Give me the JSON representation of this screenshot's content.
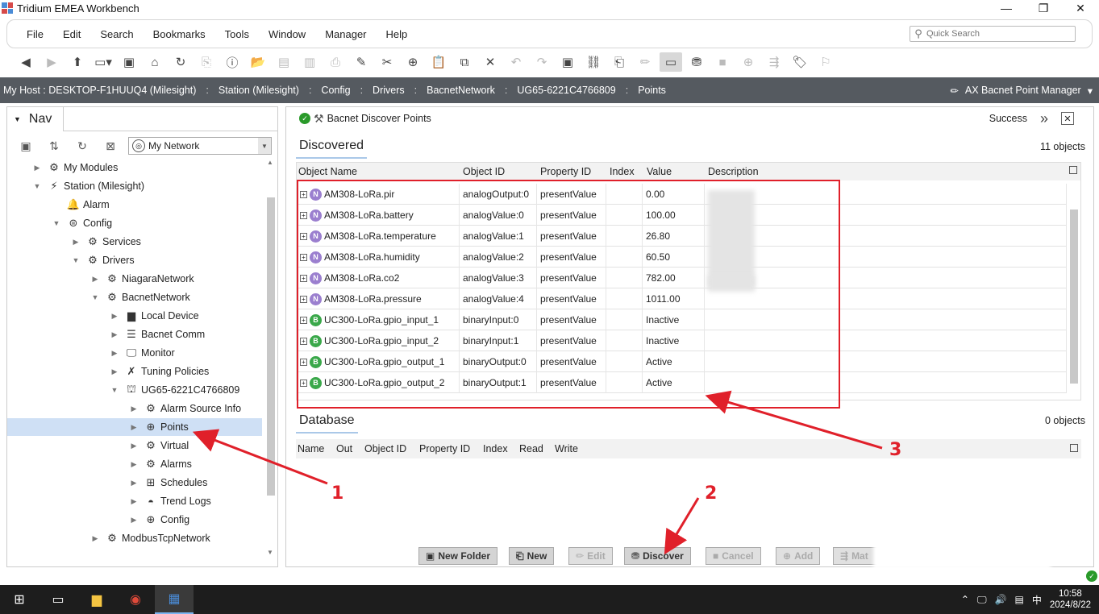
{
  "window": {
    "title": "Tridium EMEA Workbench",
    "minimize": "—",
    "maximize": "❐",
    "close": "✕"
  },
  "menu": [
    "File",
    "Edit",
    "Search",
    "Bookmarks",
    "Tools",
    "Window",
    "Manager",
    "Help"
  ],
  "quick_search": {
    "placeholder": "Quick Search"
  },
  "breadcrumb": [
    "My Host : DESKTOP-F1HUUQ4 (Milesight)",
    "Station (Milesight)",
    "Config",
    "Drivers",
    "BacnetNetwork",
    "UG65-6221C4766809",
    "Points"
  ],
  "view_selector": "AX Bacnet Point Manager",
  "nav": {
    "tab": "Nav",
    "network_select": "My Network",
    "tree": [
      {
        "label": "My Modules",
        "depth": 1,
        "exp": "▶",
        "icon": "module-icon",
        "glyph": "⚙"
      },
      {
        "label": "Station (Milesight)",
        "depth": 1,
        "exp": "▼",
        "icon": "station-icon",
        "glyph": "⚡"
      },
      {
        "label": "Alarm",
        "depth": 2,
        "exp": "",
        "icon": "bell-icon",
        "glyph": "🔔"
      },
      {
        "label": "Config",
        "depth": 2,
        "exp": "▼",
        "icon": "config-icon",
        "glyph": "⊜"
      },
      {
        "label": "Services",
        "depth": 3,
        "exp": "▶",
        "icon": "services-icon",
        "glyph": "⚙"
      },
      {
        "label": "Drivers",
        "depth": 3,
        "exp": "▼",
        "icon": "drivers-icon",
        "glyph": "⚙"
      },
      {
        "label": "NiagaraNetwork",
        "depth": 4,
        "exp": "▶",
        "icon": "network-icon",
        "glyph": "⚙"
      },
      {
        "label": "BacnetNetwork",
        "depth": 4,
        "exp": "▼",
        "icon": "network-icon",
        "glyph": "⚙"
      },
      {
        "label": "Local Device",
        "depth": 5,
        "exp": "▶",
        "icon": "device-icon",
        "glyph": "▆"
      },
      {
        "label": "Bacnet Comm",
        "depth": 5,
        "exp": "▶",
        "icon": "comm-icon",
        "glyph": "☰"
      },
      {
        "label": "Monitor",
        "depth": 5,
        "exp": "▶",
        "icon": "monitor-icon",
        "glyph": "🖵"
      },
      {
        "label": "Tuning Policies",
        "depth": 5,
        "exp": "▶",
        "icon": "tuning-icon",
        "glyph": "✗"
      },
      {
        "label": "UG65-6221C4766809",
        "depth": 5,
        "exp": "▼",
        "icon": "device-icon",
        "glyph": "⛫"
      },
      {
        "label": "Alarm Source Info",
        "depth": 6,
        "exp": "▶",
        "icon": "alarm-source-icon",
        "glyph": "⚙"
      },
      {
        "label": "Points",
        "depth": 6,
        "exp": "▶",
        "icon": "points-icon",
        "glyph": "⊕",
        "selected": true
      },
      {
        "label": "Virtual",
        "depth": 6,
        "exp": "▶",
        "icon": "virtual-icon",
        "glyph": "⚙"
      },
      {
        "label": "Alarms",
        "depth": 6,
        "exp": "▶",
        "icon": "alarms-icon",
        "glyph": "⚙"
      },
      {
        "label": "Schedules",
        "depth": 6,
        "exp": "▶",
        "icon": "schedules-icon",
        "glyph": "⊞"
      },
      {
        "label": "Trend Logs",
        "depth": 6,
        "exp": "▶",
        "icon": "trend-icon",
        "glyph": "◓"
      },
      {
        "label": "Config",
        "depth": 6,
        "exp": "▶",
        "icon": "config-icon",
        "glyph": "⊕"
      },
      {
        "label": "ModbusTcpNetwork",
        "depth": 4,
        "exp": "▶",
        "icon": "network-icon",
        "glyph": "⚙"
      }
    ]
  },
  "main": {
    "panel_title": "Bacnet Discover Points",
    "status": "Success",
    "discovered": {
      "tab": "Discovered",
      "count": "11 objects",
      "columns": [
        "Object Name",
        "Object ID",
        "Property ID",
        "Index",
        "Value",
        "Description"
      ],
      "rows": [
        {
          "type": "N",
          "color": "#9b7fcf",
          "name": "AM308-LoRa.pir",
          "object_id": "analogOutput:0",
          "property": "presentValue",
          "index": "",
          "value": "0.00"
        },
        {
          "type": "N",
          "color": "#9b7fcf",
          "name": "AM308-LoRa.battery",
          "object_id": "analogValue:0",
          "property": "presentValue",
          "index": "",
          "value": "100.00"
        },
        {
          "type": "N",
          "color": "#9b7fcf",
          "name": "AM308-LoRa.temperature",
          "object_id": "analogValue:1",
          "property": "presentValue",
          "index": "",
          "value": "26.80"
        },
        {
          "type": "N",
          "color": "#9b7fcf",
          "name": "AM308-LoRa.humidity",
          "object_id": "analogValue:2",
          "property": "presentValue",
          "index": "",
          "value": "60.50"
        },
        {
          "type": "N",
          "color": "#9b7fcf",
          "name": "AM308-LoRa.co2",
          "object_id": "analogValue:3",
          "property": "presentValue",
          "index": "",
          "value": "782.00"
        },
        {
          "type": "N",
          "color": "#9b7fcf",
          "name": "AM308-LoRa.pressure",
          "object_id": "analogValue:4",
          "property": "presentValue",
          "index": "",
          "value": "1011.00"
        },
        {
          "type": "B",
          "color": "#3aa84a",
          "name": "UC300-LoRa.gpio_input_1",
          "object_id": "binaryInput:0",
          "property": "presentValue",
          "index": "",
          "value": "Inactive"
        },
        {
          "type": "B",
          "color": "#3aa84a",
          "name": "UC300-LoRa.gpio_input_2",
          "object_id": "binaryInput:1",
          "property": "presentValue",
          "index": "",
          "value": "Inactive"
        },
        {
          "type": "B",
          "color": "#3aa84a",
          "name": "UC300-LoRa.gpio_output_1",
          "object_id": "binaryOutput:0",
          "property": "presentValue",
          "index": "",
          "value": "Active"
        },
        {
          "type": "B",
          "color": "#3aa84a",
          "name": "UC300-LoRa.gpio_output_2",
          "object_id": "binaryOutput:1",
          "property": "presentValue",
          "index": "",
          "value": "Active"
        }
      ]
    },
    "database": {
      "tab": "Database",
      "count": "0 objects",
      "columns": [
        "Name",
        "Out",
        "Object ID",
        "Property ID",
        "Index",
        "Read",
        "Write"
      ]
    },
    "buttons": {
      "new_folder": "New Folder",
      "new": "New",
      "edit": "Edit",
      "discover": "Discover",
      "cancel": "Cancel",
      "add": "Add",
      "match": "Mat"
    }
  },
  "annotations": {
    "one": "1",
    "two": "2",
    "three": "3",
    "color": "#e0202a"
  },
  "taskbar": {
    "time": "10:58",
    "date": "2024/8/22",
    "ime": "中"
  }
}
